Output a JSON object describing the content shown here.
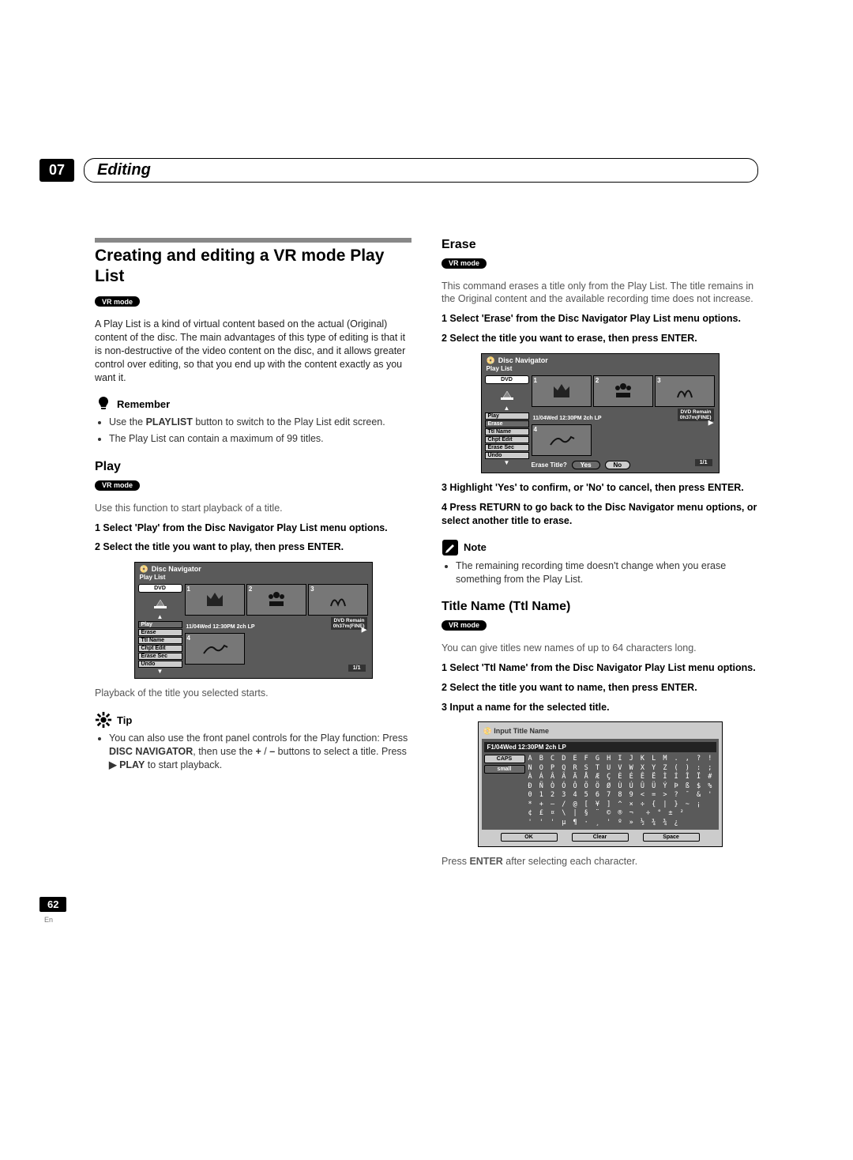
{
  "chapter": {
    "number": "07",
    "title": "Editing"
  },
  "left": {
    "h1": "Creating and editing a VR mode Play List",
    "mode": "VR mode",
    "intro": "A Play List is a kind of virtual content based on the actual (Original) content of the disc. The main advantages of this type of editing is that it is non-destructive of the video content on the disc, and it allows greater control over editing, so that you end up with the content exactly as you want it.",
    "remember_label": "Remember",
    "remember_b1a": "Use the ",
    "remember_b1b": "PLAYLIST",
    "remember_b1c": " button to switch to the Play List edit screen.",
    "remember_b2": "The Play List can contain a maximum of 99 titles.",
    "play_h": "Play",
    "play_mode": "VR mode",
    "play_intro": "Use this function to start playback of a title.",
    "play_s1": "1    Select 'Play' from the Disc Navigator Play List menu options.",
    "play_s2": "2    Select the title you want to play, then press ENTER.",
    "play_after": "Playback of the title you selected starts.",
    "tip_label": "Tip",
    "tip_a": "You can also use the front panel controls for the Play function: Press ",
    "tip_b": "DISC NAVIGATOR",
    "tip_c": ", then use the ",
    "tip_d": "+",
    "tip_e": " / ",
    "tip_f": "–",
    "tip_g": " buttons to select a title. Press ",
    "tip_h": "▶ PLAY",
    "tip_i": " to start playback."
  },
  "right": {
    "erase_h": "Erase",
    "erase_mode": "VR mode",
    "erase_intro": "This command erases a title only from the Play List. The title remains in the Original content and the available recording time does not increase.",
    "erase_s1": "1    Select 'Erase' from the Disc Navigator Play List menu options.",
    "erase_s2": "2    Select the title you want to erase, then press ENTER.",
    "erase_s3": "3    Highlight 'Yes' to confirm, or 'No' to cancel, then press ENTER.",
    "erase_s4": "4    Press RETURN to go back to the Disc Navigator menu options, or select another title to erase.",
    "note_label": "Note",
    "note_b1": "The remaining recording time doesn't change when you erase something from the Play List.",
    "ttl_h": "Title Name (Ttl Name)",
    "ttl_mode": "VR mode",
    "ttl_intro": "You can give titles new names of up to 64 characters long.",
    "ttl_s1": "1    Select 'Ttl Name' from the Disc Navigator Play List menu options.",
    "ttl_s2": "2    Select the title you want to name, then press ENTER.",
    "ttl_s3": "3    Input a name for the selected title.",
    "ttl_after_a": "Press ",
    "ttl_after_b": "ENTER",
    "ttl_after_c": " after selecting each character."
  },
  "nav": {
    "title": "Disc Navigator",
    "sub": "Play List",
    "dvd": "DVD",
    "status": "11/04Wed 12:30PM   2ch LP",
    "remain1": "DVD Remain",
    "remain2": "0h37m(FINE)",
    "page": "1/1",
    "menu_play": "Play",
    "menu_erase": "Erase",
    "menu_ttl": "Ttl Name",
    "menu_chpt": "Chpt Edit",
    "menu_esec": "Erase Sec",
    "menu_undo": "Undo",
    "confirm_q": "Erase Title?",
    "confirm_yes": "Yes",
    "confirm_no": "No"
  },
  "input": {
    "title": "Input Title Name",
    "field": "F1/04Wed 12:30PM   2ch LP",
    "caps": "CAPS",
    "small": "small",
    "row1": "A B C D E F G H I J K L M . , ? !",
    "row2": "N O P Q R S T U V W X Y Z ( ) : ;",
    "row3": "À Á Â Ã Ä Å Æ Ç È É Ê Ë Ì Í Î Ï #",
    "row4": "Ð Ñ Ò Ó Ô Õ Ö Ø Ù Ú Û Ü Ý Þ ß $ %",
    "row5": "0 1 2 3 4 5 6 7 8 9 < = > ? ¯ & '",
    "row6": "* + – / @ [ ¥ ] ^ × ÷ { | } ~ ¡",
    "row7": "¢ £ ¤ \\ | § ¨ © ® ¬ ­ ÷ ° ± ²",
    "row8": "' ' ' µ ¶ · ¸ ' º » ½ ¾ ¾ ¿",
    "ok": "OK",
    "clear": "Clear",
    "space": "Space"
  },
  "footer": {
    "page": "62",
    "lang": "En"
  }
}
